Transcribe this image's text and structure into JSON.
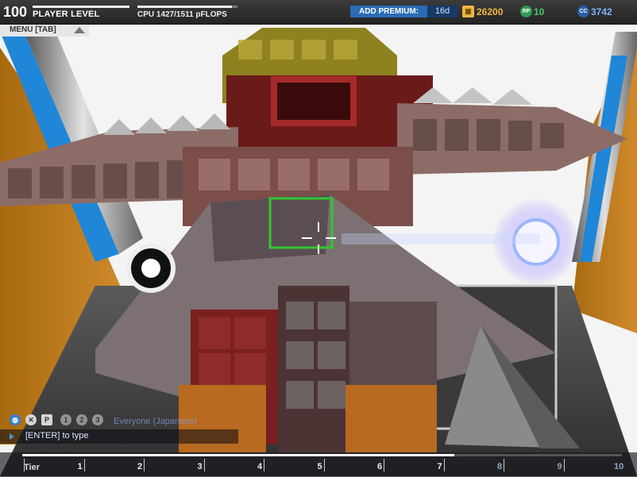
{
  "hud": {
    "player_level": "100",
    "player_level_label": "PLAYER LEVEL",
    "level_progress": 1.0,
    "cpu_label": "CPU 1427/1511 pFLOPS",
    "cpu_progress": 0.944,
    "add_premium_label": "ADD PREMIUM:",
    "premium_days": "16d",
    "credits": "26200",
    "reward_points": "10",
    "cosmetic_credits": "3742",
    "colors": {
      "premium_blue": "#2a6bb6",
      "credits_color": "#f0b640",
      "rp_color": "#4cc870",
      "cc_color": "#7fb4ff"
    },
    "icons": [
      "credits-icon",
      "robit-points-icon",
      "cosmetic-credits-icon"
    ]
  },
  "menu": {
    "label": "MENU [TAB]"
  },
  "chat": {
    "channel": "Everyone (Japanese)",
    "prompt": "[ENTER] to type",
    "icons": [
      "globe-icon",
      "faction-icon",
      "party-icon",
      "friends-icon",
      "clan-icon",
      "custom-game-icon"
    ],
    "icon_glyphs": [
      "P",
      "1",
      "2",
      "3"
    ]
  },
  "tier": {
    "label": "Tier",
    "numbers": [
      "1",
      "2",
      "3",
      "4",
      "5",
      "6",
      "7",
      "8",
      "9",
      "10"
    ],
    "progress": 0.72
  }
}
